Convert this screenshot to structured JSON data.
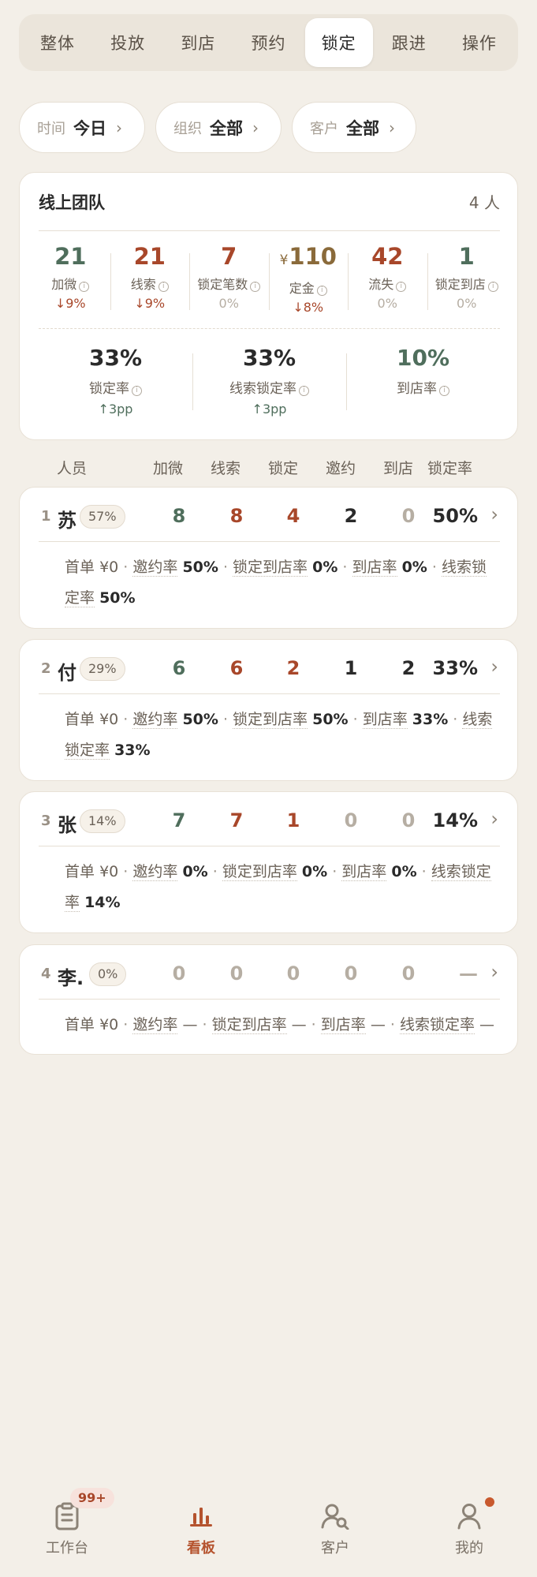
{
  "tabs": [
    "整体",
    "投放",
    "到店",
    "预约",
    "锁定",
    "跟进",
    "操作"
  ],
  "active_tab": "锁定",
  "filters": [
    {
      "key": "时间",
      "value": "今日"
    },
    {
      "key": "组织",
      "value": "全部"
    },
    {
      "key": "客户",
      "value": "全部"
    }
  ],
  "summary": {
    "title": "线上团队",
    "count": "4 人",
    "metrics": [
      {
        "value": "21",
        "label": "加微",
        "delta": "↓9%"
      },
      {
        "value": "21",
        "label": "线索",
        "delta": "↓9%"
      },
      {
        "value": "7",
        "label": "锁定笔数",
        "delta": "0%"
      },
      {
        "currency": "¥",
        "value": "110",
        "label": "定金",
        "delta": "↓8%"
      },
      {
        "value": "42",
        "label": "流失",
        "delta": "0%"
      },
      {
        "value": "1",
        "label": "锁定到店",
        "delta": "0%"
      }
    ],
    "rates": [
      {
        "value": "33%",
        "label": "锁定率",
        "delta": "↑3pp"
      },
      {
        "value": "33%",
        "label": "线索锁定率",
        "delta": "↑3pp"
      },
      {
        "value": "10%",
        "label": "到店率",
        "delta": ""
      }
    ]
  },
  "columns": [
    "人员",
    "加微",
    "线索",
    "锁定",
    "邀约",
    "到店",
    "锁定率"
  ],
  "people": [
    {
      "rank": "1",
      "name": "苏",
      "pct": "57%",
      "values": [
        "8",
        "8",
        "4",
        "2",
        "0"
      ],
      "rate": "50%",
      "detail": {
        "first_label": "首单",
        "first_value": "¥0",
        "invite_label": "邀约率",
        "invite_value": "50%",
        "lock_visit_label": "锁定到店率",
        "lock_visit_value": "0%",
        "visit_label": "到店率",
        "visit_value": "0%",
        "lead_lock_label": "线索锁定率",
        "lead_lock_value": "50%"
      }
    },
    {
      "rank": "2",
      "name": "付",
      "pct": "29%",
      "values": [
        "6",
        "6",
        "2",
        "1",
        "2"
      ],
      "rate": "33%",
      "detail": {
        "first_label": "首单",
        "first_value": "¥0",
        "invite_label": "邀约率",
        "invite_value": "50%",
        "lock_visit_label": "锁定到店率",
        "lock_visit_value": "50%",
        "visit_label": "到店率",
        "visit_value": "33%",
        "lead_lock_label": "线索锁定率",
        "lead_lock_value": "33%"
      }
    },
    {
      "rank": "3",
      "name": "张",
      "pct": "14%",
      "values": [
        "7",
        "7",
        "1",
        "0",
        "0"
      ],
      "rate": "14%",
      "detail": {
        "first_label": "首单",
        "first_value": "¥0",
        "invite_label": "邀约率",
        "invite_value": "0%",
        "lock_visit_label": "锁定到店率",
        "lock_visit_value": "0%",
        "visit_label": "到店率",
        "visit_value": "0%",
        "lead_lock_label": "线索锁定率",
        "lead_lock_value": "14%"
      }
    },
    {
      "rank": "4",
      "name": "李.",
      "pct": "0%",
      "values": [
        "0",
        "0",
        "0",
        "0",
        "0"
      ],
      "rate": "—",
      "detail": {
        "first_label": "首单",
        "first_value": "¥0",
        "invite_label": "邀约率",
        "invite_value": "—",
        "lock_visit_label": "锁定到店率",
        "lock_visit_value": "—",
        "visit_label": "到店率",
        "visit_value": "—",
        "lead_lock_label": "线索锁定率",
        "lead_lock_value": "—"
      }
    }
  ],
  "nav": {
    "items": [
      {
        "label": "工作台",
        "icon": "clipboard-icon"
      },
      {
        "label": "看板",
        "icon": "bar-chart-icon"
      },
      {
        "label": "客户",
        "icon": "customer-search-icon"
      },
      {
        "label": "我的",
        "icon": "user-icon"
      }
    ],
    "badge": "99+",
    "active": "看板"
  },
  "colors": {
    "background": "#f3efe8",
    "accent": "#b5532e",
    "green": "#4f6e5c",
    "red": "#a8472a",
    "gold": "#8a6a3a",
    "gray": "#b6aea3"
  }
}
